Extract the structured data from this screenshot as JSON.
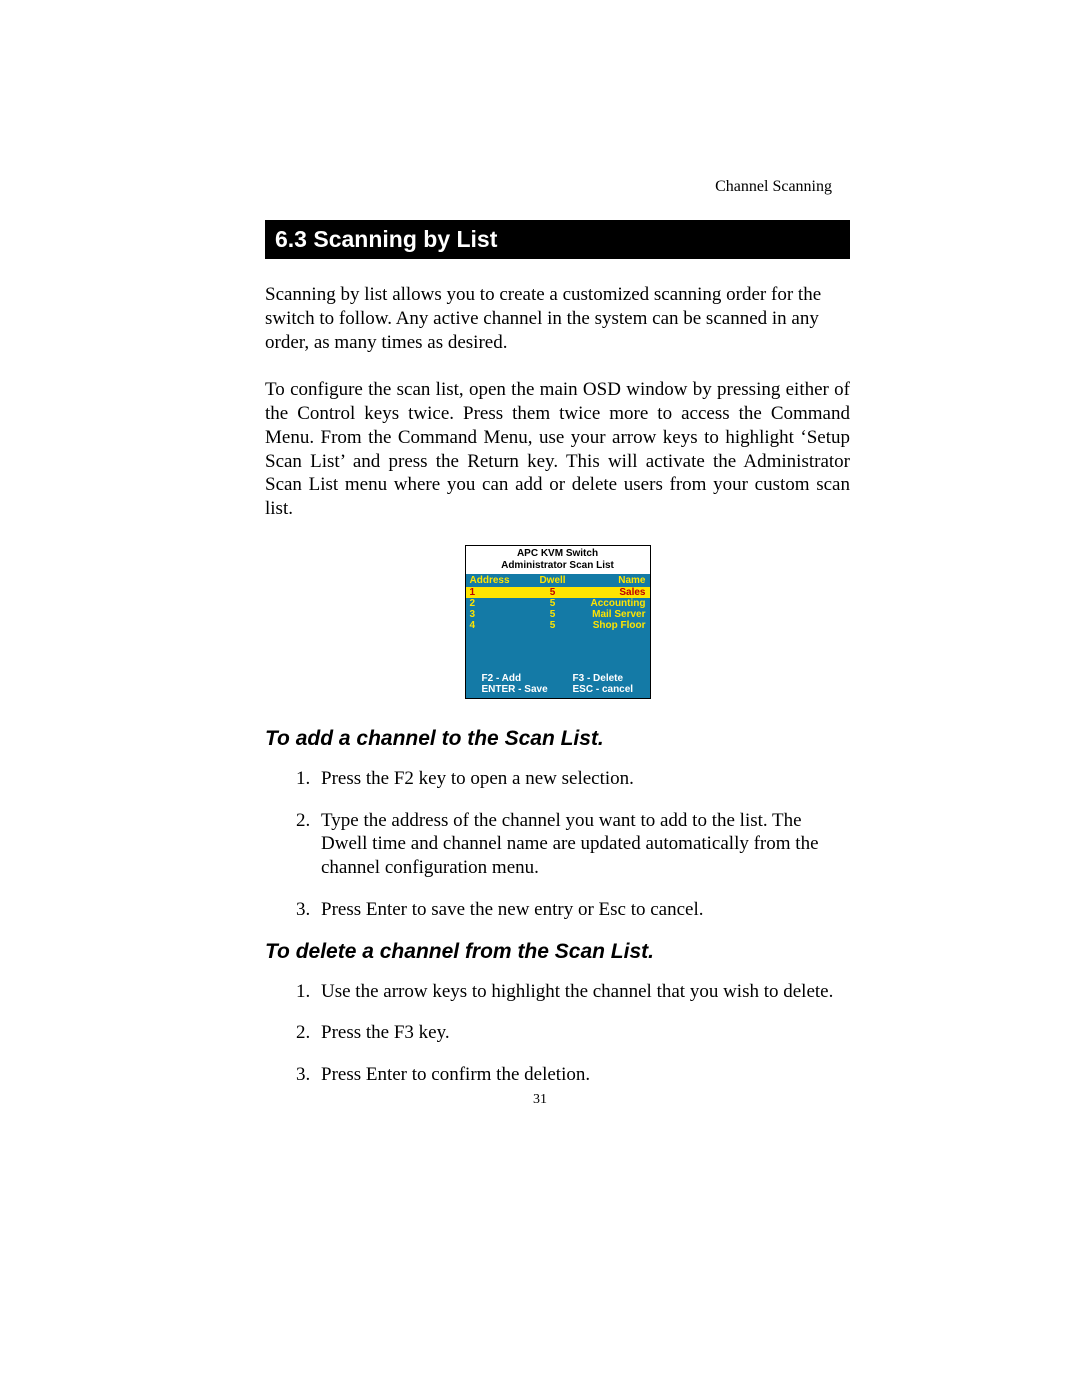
{
  "page": {
    "running_head": "Channel Scanning",
    "number": "31"
  },
  "heading": "6.3 Scanning by List",
  "intro_para": "Scanning by list allows you to create a customized scanning order for the switch to follow. Any active channel in the system can be scanned in any order, as many times as desired.",
  "config_para": "To configure the scan list, open the main OSD window by pressing either of the Control keys twice. Press them twice more to access the Command Menu. From the Command Menu, use your arrow keys to highlight ‘Setup Scan List’ and press the Return key. This will activate the Administrator Scan List menu where you can add or delete users from your custom scan list.",
  "osd": {
    "title1": "APC KVM Switch",
    "title2": "Administrator Scan List",
    "columns": {
      "address": "Address",
      "dwell": "Dwell",
      "name": "Name"
    },
    "rows": [
      {
        "address": "1",
        "dwell": "5",
        "name": "Sales",
        "selected": true
      },
      {
        "address": "2",
        "dwell": "5",
        "name": "Accounting",
        "selected": false
      },
      {
        "address": "3",
        "dwell": "5",
        "name": "Mail Server",
        "selected": false
      },
      {
        "address": "4",
        "dwell": "5",
        "name": "Shop Floor",
        "selected": false
      }
    ],
    "footer": {
      "f2": "F2 - Add",
      "f3": "F3 - Delete",
      "enter": "ENTER - Save",
      "esc": "ESC - cancel"
    }
  },
  "add_section": {
    "heading": "To add a channel to the Scan List.",
    "steps": [
      "Press the F2 key to open a new selection.",
      "Type the address of the channel you want to add to the list. The Dwell time and channel name are updated automatically from the channel configuration menu.",
      " Press Enter to save the new entry or Esc to cancel."
    ]
  },
  "delete_section": {
    "heading": "To delete a channel from the Scan List.",
    "steps": [
      "Use the arrow keys to highlight the channel that you wish to delete.",
      "Press the F3 key.",
      "Press Enter to confirm the deletion."
    ]
  }
}
